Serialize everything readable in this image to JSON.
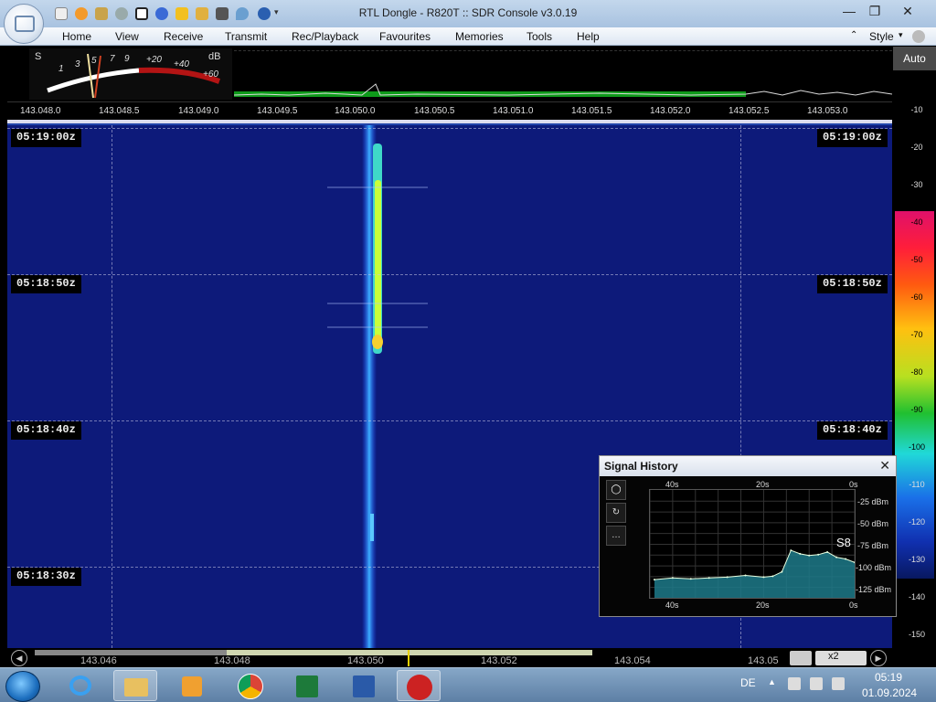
{
  "window": {
    "title": "RTL Dongle - R820T :: SDR Console v3.0.19",
    "minimize": "—",
    "maximize": "❐",
    "close": "✕"
  },
  "menu": {
    "items": [
      "Home",
      "View",
      "Receive",
      "Transmit",
      "Rec/Playback",
      "Favourites",
      "Memories",
      "Tools",
      "Help"
    ],
    "style_label": "Style"
  },
  "meter": {
    "s_label": "S",
    "db_label": "dB",
    "scale_s": [
      "1",
      "3",
      "5",
      "7",
      "9"
    ],
    "scale_plus": [
      "+20",
      "+40",
      "+60"
    ]
  },
  "freq_axis": {
    "labels": [
      "143.048.0",
      "143.048.5",
      "143.049.0",
      "143.049.5",
      "143.050.0",
      "143.050.5",
      "143.051.0",
      "143.051.5",
      "143.052.0",
      "143.052.5",
      "143.053.0"
    ]
  },
  "waterfall": {
    "timestamps": [
      "05:19:00z",
      "05:18:50z",
      "05:18:40z",
      "05:18:30z"
    ],
    "signal_freq": "143.050.0"
  },
  "level_scale": {
    "auto_label": "Auto",
    "ticks": [
      "-10",
      "-20",
      "-30",
      "-40",
      "-50",
      "-60",
      "-70",
      "-80",
      "-90",
      "-100",
      "-110",
      "-120",
      "-130",
      "-140",
      "-150"
    ]
  },
  "bottom_axis": {
    "labels": [
      "143.046",
      "143.048",
      "143.050",
      "143.052",
      "143.054",
      "143.05"
    ],
    "zoom": "x2"
  },
  "signal_history": {
    "title": "Signal History",
    "close": "✕",
    "buttons": [
      "◯",
      "↻",
      "…"
    ],
    "x_ticks": [
      "40s",
      "20s",
      "0s"
    ],
    "y_ticks": [
      "-25 dBm",
      "-50 dBm",
      "-75 dBm",
      "-100 dBm",
      "-125 dBm"
    ],
    "current_s": "S8"
  },
  "chart_data": {
    "type": "area",
    "xlabel": "",
    "ylabel": "",
    "x": [
      -44,
      -40,
      -36,
      -32,
      -28,
      -24,
      -20,
      -18,
      -16,
      -14,
      -12,
      -10,
      -8,
      -6,
      -4,
      -2,
      0
    ],
    "values": [
      -116,
      -114,
      -115,
      -114,
      -113,
      -111,
      -113,
      -112,
      -107,
      -82,
      -86,
      -88,
      -87,
      -84,
      -90,
      -92,
      -96
    ],
    "ylim": [
      -137,
      -12
    ],
    "xlim": [
      -45,
      0
    ],
    "grid": true
  },
  "taskbar": {
    "language": "DE",
    "time": "05:19",
    "date": "01.09.2024"
  },
  "colors": {
    "waterfall_bg": "#0d1a7a",
    "signal": "#c8ff3a",
    "spectrum_floor": "#0e9a1a",
    "history_fill": "#1d7a8a",
    "history_line": "#e8ffe0"
  }
}
